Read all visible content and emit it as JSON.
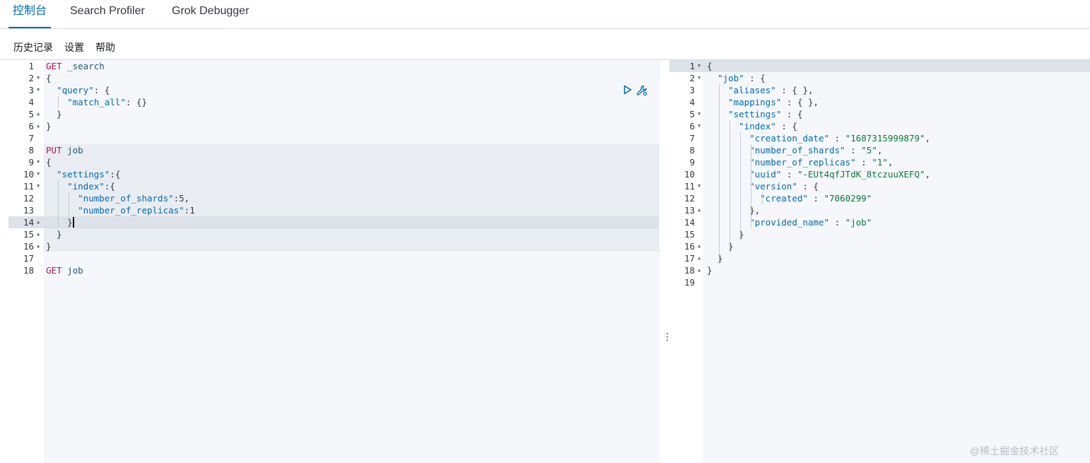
{
  "tabs": [
    "控制台",
    "Search Profiler",
    "Grok Debugger"
  ],
  "menu": [
    "历史记录",
    "设置",
    "帮助"
  ],
  "request_lines": [
    [
      [
        "k-method",
        "GET"
      ],
      [
        "k-path",
        " _search"
      ]
    ],
    [
      [
        "k-punct",
        "{"
      ]
    ],
    [
      [
        "k-punct",
        "  "
      ],
      [
        "k-str",
        "\"query\""
      ],
      [
        "k-punct",
        ": {"
      ]
    ],
    [
      [
        "k-punct",
        "    "
      ],
      [
        "k-str",
        "\"match_all\""
      ],
      [
        "k-punct",
        ": {}"
      ]
    ],
    [
      [
        "k-punct",
        "  }"
      ]
    ],
    [
      [
        "k-punct",
        "}"
      ]
    ],
    [],
    [
      [
        "k-method",
        "PUT"
      ],
      [
        "k-path",
        " job"
      ]
    ],
    [
      [
        "k-punct",
        "{"
      ]
    ],
    [
      [
        "k-punct",
        "  "
      ],
      [
        "k-str",
        "\"settings\""
      ],
      [
        "k-punct",
        ":{"
      ]
    ],
    [
      [
        "k-punct",
        "    "
      ],
      [
        "k-str",
        "\"index\""
      ],
      [
        "k-punct",
        ":{"
      ]
    ],
    [
      [
        "k-punct",
        "      "
      ],
      [
        "k-str",
        "\"number_of_shards\""
      ],
      [
        "k-punct",
        ":5,"
      ]
    ],
    [
      [
        "k-punct",
        "      "
      ],
      [
        "k-str",
        "\"number_of_replicas\""
      ],
      [
        "k-punct",
        ":1"
      ]
    ],
    [
      [
        "k-punct",
        "    }"
      ]
    ],
    [
      [
        "k-punct",
        "  }"
      ]
    ],
    [
      [
        "k-punct",
        "}"
      ]
    ],
    [],
    [
      [
        "k-method",
        "GET"
      ],
      [
        "k-path",
        " job"
      ]
    ]
  ],
  "request_folds": {
    "2": true,
    "3": true,
    "5": false,
    "6": false,
    "9": true,
    "10": true,
    "11": true,
    "14": false,
    "15": false,
    "16": false
  },
  "response_lines": [
    [
      [
        "k-punct",
        "{"
      ]
    ],
    [
      [
        "k-punct",
        "  "
      ],
      [
        "k-str",
        "\"job\""
      ],
      [
        "k-punct",
        " : {"
      ]
    ],
    [
      [
        "k-punct",
        "    "
      ],
      [
        "k-str",
        "\"aliases\""
      ],
      [
        "k-punct",
        " : { },"
      ]
    ],
    [
      [
        "k-punct",
        "    "
      ],
      [
        "k-str",
        "\"mappings\""
      ],
      [
        "k-punct",
        " : { },"
      ]
    ],
    [
      [
        "k-punct",
        "    "
      ],
      [
        "k-str",
        "\"settings\""
      ],
      [
        "k-punct",
        " : {"
      ]
    ],
    [
      [
        "k-punct",
        "      "
      ],
      [
        "k-str",
        "\"index\""
      ],
      [
        "k-punct",
        " : {"
      ]
    ],
    [
      [
        "k-punct",
        "        "
      ],
      [
        "k-str",
        "\"creation_date\""
      ],
      [
        "k-punct",
        " : "
      ],
      [
        "k-val",
        "\"1687315999879\""
      ],
      [
        "k-punct",
        ","
      ]
    ],
    [
      [
        "k-punct",
        "        "
      ],
      [
        "k-str",
        "\"number_of_shards\""
      ],
      [
        "k-punct",
        " : "
      ],
      [
        "k-val",
        "\"5\""
      ],
      [
        "k-punct",
        ","
      ]
    ],
    [
      [
        "k-punct",
        "        "
      ],
      [
        "k-str",
        "\"number_of_replicas\""
      ],
      [
        "k-punct",
        " : "
      ],
      [
        "k-val",
        "\"1\""
      ],
      [
        "k-punct",
        ","
      ]
    ],
    [
      [
        "k-punct",
        "        "
      ],
      [
        "k-str",
        "\"uuid\""
      ],
      [
        "k-punct",
        " : "
      ],
      [
        "k-val",
        "\"-EUt4qfJTdK_8tczuuXEFQ\""
      ],
      [
        "k-punct",
        ","
      ]
    ],
    [
      [
        "k-punct",
        "        "
      ],
      [
        "k-str",
        "\"version\""
      ],
      [
        "k-punct",
        " : {"
      ]
    ],
    [
      [
        "k-punct",
        "          "
      ],
      [
        "k-str",
        "\"created\""
      ],
      [
        "k-punct",
        " : "
      ],
      [
        "k-val",
        "\"7060299\""
      ]
    ],
    [
      [
        "k-punct",
        "        },"
      ]
    ],
    [
      [
        "k-punct",
        "        "
      ],
      [
        "k-str",
        "\"provided_name\""
      ],
      [
        "k-punct",
        " : "
      ],
      [
        "k-val",
        "\"job\""
      ]
    ],
    [
      [
        "k-punct",
        "      }"
      ]
    ],
    [
      [
        "k-punct",
        "    }"
      ]
    ],
    [
      [
        "k-punct",
        "  }"
      ]
    ],
    [
      [
        "k-punct",
        "}"
      ]
    ],
    []
  ],
  "response_folds": {
    "1": true,
    "2": true,
    "5": true,
    "6": true,
    "11": true,
    "13": false,
    "16": false,
    "17": false,
    "18": false
  },
  "icons": {
    "run": "play-icon",
    "settings": "wrench-icon",
    "divider": "vertical-dots-icon"
  },
  "watermark": "@稀土掘金技术社区"
}
